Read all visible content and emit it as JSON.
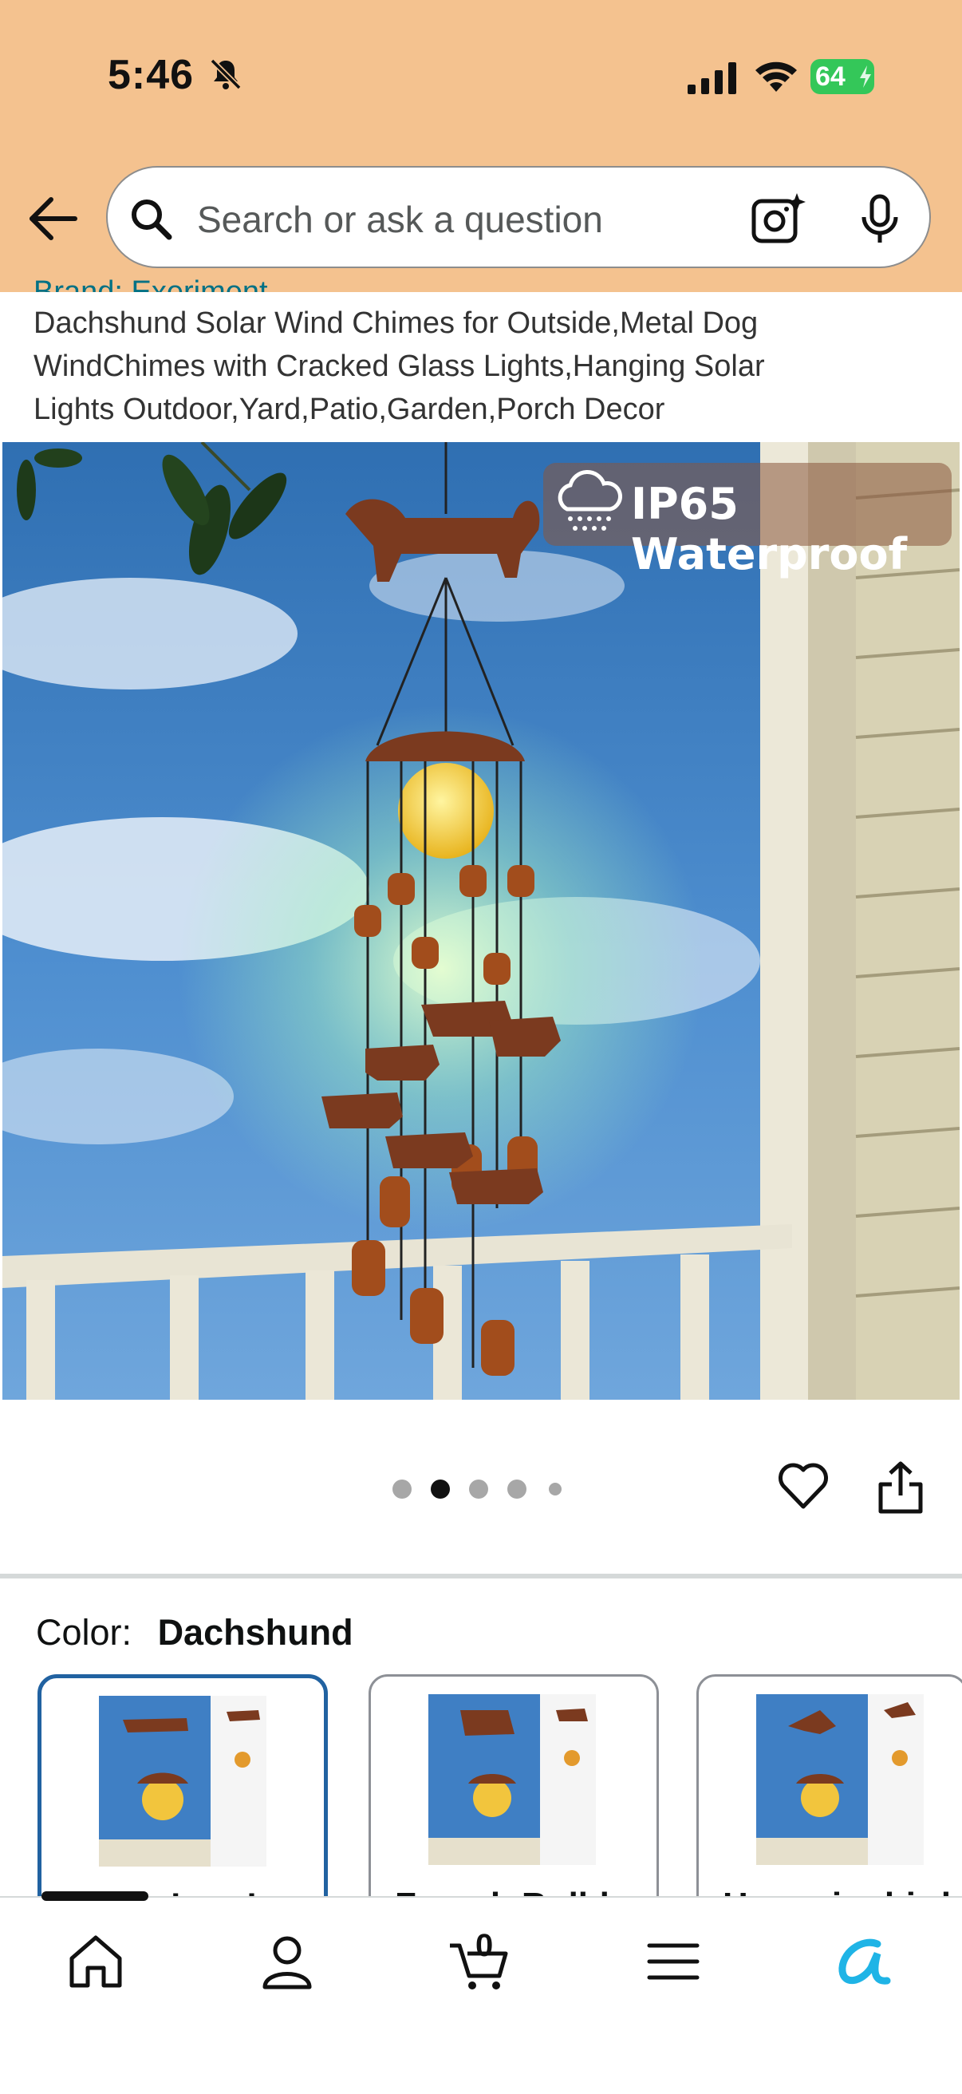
{
  "status": {
    "time": "5:46",
    "battery": "64"
  },
  "search": {
    "placeholder": "Search or ask a question"
  },
  "product": {
    "brand": "Brand: Exeriment",
    "title_lines": [
      "Dachshund Solar Wind Chimes for Outside,Metal Dog",
      "WindChimes with Cracked Glass Lights,Hanging Solar",
      "Lights Outdoor,Yard,Patio,Garden,Porch Decor"
    ],
    "badge": "IP65 Waterproof"
  },
  "gallery": {
    "dot_count": 5,
    "active_index": 1
  },
  "color": {
    "label": "Color:",
    "selected": "Dachshund",
    "options": [
      {
        "label": "Dachshund",
        "selected": true
      },
      {
        "label": "French Bulldog",
        "selected": false
      },
      {
        "label": "Hummingbird",
        "selected": false
      }
    ]
  },
  "nav": {
    "cart_count": "0"
  },
  "colors": {
    "header": "#f4c28f",
    "accent": "#2162a1",
    "battery": "#34c759"
  }
}
